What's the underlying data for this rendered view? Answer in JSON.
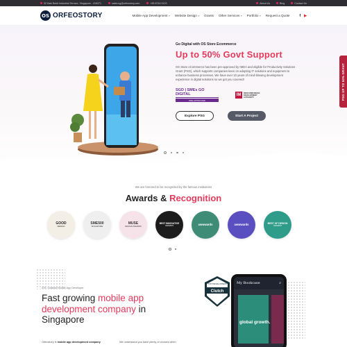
{
  "topbar": {
    "address": "32 Kaki Bukit Industrial Terrace, Singapore - 416371",
    "email": "sales.sg@orfeostory.com",
    "phone": "+65 8744 0123",
    "about": "About Us",
    "blog": "Blog",
    "contact": "Contact Us"
  },
  "header": {
    "logo_mark": "OS",
    "logo_text": "ORFEOSTORY",
    "nav": [
      {
        "label": "Mobile App Development",
        "dropdown": true
      },
      {
        "label": "Website Design",
        "dropdown": true
      },
      {
        "label": "Grants",
        "dropdown": false
      },
      {
        "label": "Other Services",
        "dropdown": true
      },
      {
        "label": "Portfolio",
        "dropdown": true
      },
      {
        "label": "Request a Quote",
        "dropdown": false
      }
    ],
    "social": [
      "f",
      "▶"
    ]
  },
  "hero": {
    "kicker": "Go Digital with OS Store Ecommerce",
    "title": "Up to 50% Govt Support",
    "description": "OS Store eCommerce has been pre-approved by IMDA and eligible for Productivity Solutions Grant (PSG), which supports companies keen on adopting IT solutions and equipment to enhance business processes. We have over 10 years of mind-blowing development experience in digital solutions so we got you covered!",
    "badge_sgd_main": "SGD | SMEs GO DIGITAL",
    "badge_sgd_sub": "PRE-APPROVED",
    "badge_imda_mark": "IM",
    "badge_imda_text": "INFOCOMM MEDIA DEVELOPMENT AUTHORITY",
    "btn_explore": "Explore PSG",
    "btn_start": "Start A Project",
    "slide_count": 4,
    "active_slide": 1
  },
  "side_tab": "PSG UP TO 50% GRANT",
  "awards": {
    "subtitle": "We are honored to be recognized by the famous institutions",
    "title_a": "Awards",
    "title_amp": " & ",
    "title_b": "Recognition",
    "items": [
      {
        "main": "GOOD",
        "sub": "DESIGN",
        "bg": "#f4efe6",
        "fg": "#222222"
      },
      {
        "main": "SME500",
        "sub": "SINGAPORE",
        "bg": "#efefef",
        "fg": "#333333"
      },
      {
        "main": "MUSE",
        "sub": "DESIGN AWARDS",
        "bg": "#f6e3ea",
        "fg": "#333333"
      },
      {
        "main": "BEST INNOVATIVE",
        "sub": "AWARDS",
        "bg": "#1c1c1c",
        "fg": "#ffffff"
      },
      {
        "main": "awwwards",
        "sub": "",
        "bg": "#3e8c76",
        "fg": "#ffffff"
      },
      {
        "main": "awwwards",
        "sub": "",
        "bg": "#5a4fc0",
        "fg": "#ffffff"
      },
      {
        "main": "BEST OF DESIGN",
        "sub": "AWARDS",
        "bg": "#2f9c8a",
        "fg": "#ffffff"
      }
    ]
  },
  "bottom": {
    "kicker": "iOS / Android Mobile App Developer",
    "title_a": "Fast growing ",
    "title_b": "mobile app development company",
    "title_c": " in Singapore",
    "col1_bold": "mobile app development company",
    "col1_pre": "Orfeostory is ",
    "col2": "We understand you have plenty of choices when",
    "clutch_top": "TOP DEVELOPERS",
    "clutch_name": "Clutch",
    "phone_title": "My Bookcase",
    "book_text": "global growth."
  }
}
